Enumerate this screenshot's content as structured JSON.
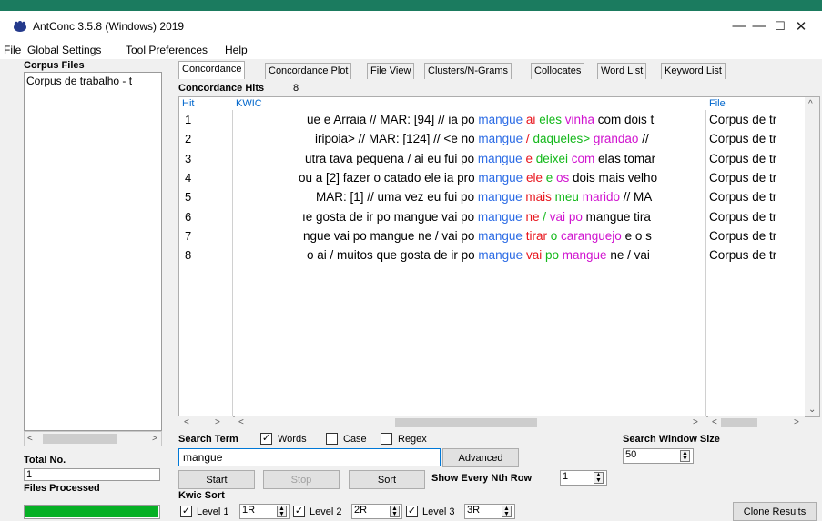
{
  "window": {
    "title": "AntConc 3.5.8 (Windows) 2019",
    "minimize_label": "—",
    "maximize_label": "☐",
    "close_label": "✕"
  },
  "menu": [
    "File",
    "Global Settings",
    "Tool Preferences",
    "Help"
  ],
  "left_panel": {
    "corpus_files_label": "Corpus Files",
    "corpus_files": [
      "Corpus de trabalho - t"
    ],
    "total_no_label": "Total No.",
    "total_no_value": "1",
    "files_processed_label": "Files Processed",
    "progress_fraction": 1.0
  },
  "tabs": [
    "Concordance",
    "Concordance Plot",
    "File View",
    "Clusters/N-Grams",
    "Collocates",
    "Word List",
    "Keyword List"
  ],
  "active_tab": "Concordance",
  "concordance": {
    "hits_label": "Concordance Hits",
    "hits_count": "8",
    "col_hit": "Hit",
    "col_kwic": "KWIC",
    "col_file": "File",
    "rows": [
      {
        "hit": "1",
        "left": "ue e Arraia // MAR: [94] // ia po ",
        "kw": "mangue",
        "w1": "ai",
        "w2": "eles",
        "w3": "vinha",
        "rest": " com dois t",
        "file": "Corpus de tr"
      },
      {
        "hit": "2",
        "left": "iripoia> // MAR: [124] // <e no ",
        "kw": "mangue",
        "w1": "/",
        "w2": "daqueles>",
        "w3": "grandao",
        "rest": " //",
        "file": "Corpus de tr"
      },
      {
        "hit": "3",
        "left": "utra tava pequena / ai eu fui po ",
        "kw": "mangue",
        "w1": "e",
        "w2": "deixei",
        "w3": "com",
        "rest": " elas tomar",
        "file": "Corpus de tr"
      },
      {
        "hit": "4",
        "left": "ou a [2] fazer o catado ele ia pro ",
        "kw": "mangue",
        "w1": "ele",
        "w2": "e",
        "w3": "os",
        "rest": " dois mais velho",
        "file": "Corpus de tr"
      },
      {
        "hit": "5",
        "left": "MAR: [1] // uma vez eu fui po ",
        "kw": "mangue",
        "w1": "mais",
        "w2": "meu",
        "w3": "marido",
        "rest": " // MA",
        "file": "Corpus de tr"
      },
      {
        "hit": "6",
        "left": "ıe gosta de ir po mangue vai po ",
        "kw": "mangue",
        "w1": "ne",
        "w2": "/",
        "w3": "vai",
        "w4": "po",
        "rest": " mangue tira",
        "file": "Corpus de tr"
      },
      {
        "hit": "7",
        "left": "ngue vai po mangue ne / vai po ",
        "kw": "mangue",
        "w1": "tirar",
        "w2": "o",
        "w3": "caranguejo",
        "rest": " e o s",
        "file": "Corpus de tr"
      },
      {
        "hit": "8",
        "left": "o ai / muitos que gosta de ir po ",
        "kw": "mangue",
        "w1": "vai",
        "w2": "po",
        "w3": "mangue",
        "rest": " ne / vai",
        "file": "Corpus de tr"
      }
    ]
  },
  "search": {
    "search_term_label": "Search Term",
    "words_label": "Words",
    "words_checked": true,
    "case_label": "Case",
    "case_checked": false,
    "regex_label": "Regex",
    "regex_checked": false,
    "value": "mangue",
    "advanced_label": "Advanced",
    "window_size_label": "Search Window Size",
    "window_size_value": "50",
    "start_label": "Start",
    "stop_label": "Stop",
    "sort_label": "Sort",
    "show_nth_label": "Show Every Nth Row",
    "show_nth_value": "1"
  },
  "kwic_sort": {
    "label": "Kwic Sort",
    "level1_label": "Level 1",
    "level1_value": "1R",
    "level2_label": "Level 2",
    "level2_value": "2R",
    "level3_label": "Level 3",
    "level3_value": "3R",
    "clone_label": "Clone Results"
  },
  "colors": {
    "keyword": "#2b6be5",
    "level1": "#e8141c",
    "level2": "#13b81a",
    "level3": "#d012cf",
    "progress": "#06b025"
  }
}
